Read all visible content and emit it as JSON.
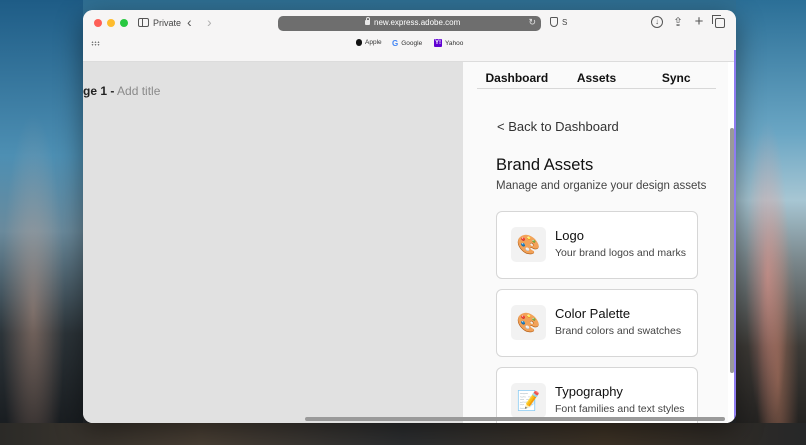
{
  "browser": {
    "private_label": "Private",
    "url": "new.express.adobe.com",
    "tab_indicator": "S",
    "bookmarks": [
      {
        "label": "Apple"
      },
      {
        "label": "Google"
      },
      {
        "label": "Yahoo"
      }
    ]
  },
  "canvas": {
    "page_label": "ge 1 -",
    "add_title": "Add title"
  },
  "panel": {
    "tabs": [
      "Dashboard",
      "Assets",
      "Sync"
    ],
    "back_link": "< Back to Dashboard",
    "title": "Brand Assets",
    "subtitle": "Manage and organize your design assets",
    "cards": [
      {
        "title": "Logo",
        "description": "Your brand logos and marks",
        "icon": "palette-icon",
        "glyph": "🎨"
      },
      {
        "title": "Color Palette",
        "description": "Brand colors and swatches",
        "icon": "palette-icon",
        "glyph": "🎨"
      },
      {
        "title": "Typography",
        "description": "Font families and text styles",
        "icon": "memo-icon",
        "glyph": "📝"
      }
    ]
  },
  "colors": {
    "accent_purple": "#8e7cf0",
    "canvas_bg": "#e1e1e1",
    "panel_bg": "#fafafa"
  }
}
